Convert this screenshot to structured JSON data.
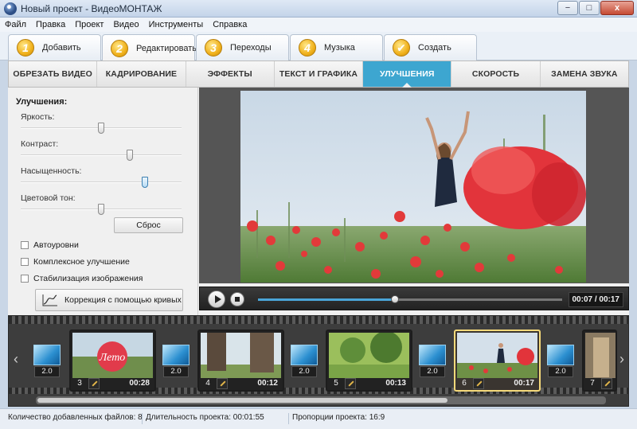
{
  "window": {
    "title": "Новый проект - ВидеоМОНТАЖ",
    "min": "−",
    "max": "□",
    "close": "x"
  },
  "menu": [
    "Файл",
    "Правка",
    "Проект",
    "Видео",
    "Инструменты",
    "Справка"
  ],
  "steps": [
    {
      "num": "1",
      "label": "Добавить"
    },
    {
      "num": "2",
      "label": "Редактировать"
    },
    {
      "num": "3",
      "label": "Переходы"
    },
    {
      "num": "4",
      "label": "Музыка"
    },
    {
      "num": "✔",
      "label": "Создать"
    }
  ],
  "subtabs": [
    "ОБРЕЗАТЬ ВИДЕО",
    "КАДРИРОВАНИЕ",
    "ЭФФЕКТЫ",
    "ТЕКСТ И ГРАФИКА",
    "УЛУЧШЕНИЯ",
    "СКОРОСТЬ",
    "ЗАМЕНА ЗВУКА"
  ],
  "enhance": {
    "title": "Улучшения:",
    "sliders": [
      {
        "label": "Яркость:",
        "value": 0.5
      },
      {
        "label": "Контраст:",
        "value": 0.68
      },
      {
        "label": "Насыщенность:",
        "value": 0.77
      },
      {
        "label": "Цветовой тон:",
        "value": 0.5
      }
    ],
    "reset": "Сброс",
    "checks": [
      "Автоуровни",
      "Комплексное улучшение",
      "Стабилизация изображения"
    ],
    "curves": "Коррекция с помощью кривых"
  },
  "player": {
    "time": "00:07 / 00:17",
    "progress": 0.45
  },
  "timeline": {
    "clips": [
      {
        "idx": "3",
        "dur": "00:28",
        "overlay": "Лето"
      },
      {
        "idx": "4",
        "dur": "00:12"
      },
      {
        "idx": "5",
        "dur": "00:13"
      },
      {
        "idx": "6",
        "dur": "00:17"
      },
      {
        "idx": "7",
        "dur": ""
      }
    ],
    "transitions": [
      "2.0",
      "2.0",
      "2.0",
      "2.0",
      "2.0"
    ]
  },
  "status": {
    "files": "Количество добавленных файлов: 8",
    "duration": "Длительность проекта:    00:01:55",
    "aspect": "Пропорции проекта:    16:9"
  },
  "colors": {
    "accent": "#3da6d0",
    "step_badge": "#f0b11c",
    "selected_clip": "#f5d97a"
  }
}
